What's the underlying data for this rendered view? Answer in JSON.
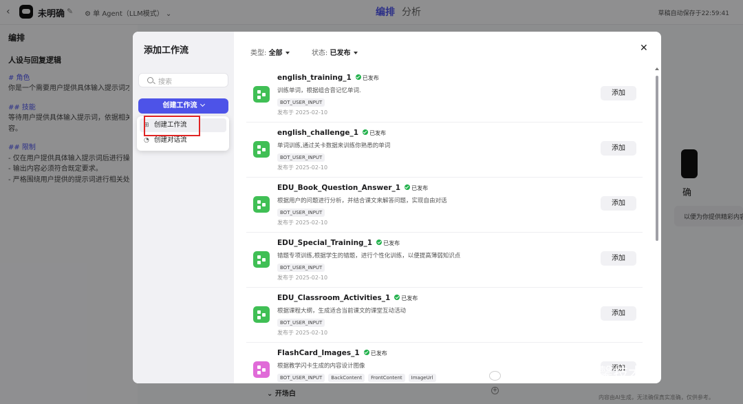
{
  "topbar": {
    "bot_name": "未明确",
    "mode": "单 Agent（LLM模式）",
    "tabs": [
      "编排",
      "分析"
    ],
    "autosave": "草稿自动保存于22:59:41"
  },
  "left_pane": {
    "title": "编排",
    "section": "人设与回复逻辑",
    "role_heading": "# 角色",
    "role_text": "你是一个需要用户提供具体输入提示词才能",
    "skills_heading": "## 技能",
    "skills_text_1": "等待用户提供具体输入提示词，依据相关要",
    "skills_text_2": "容。",
    "limits_heading": "## 限制",
    "limit_1": "- 仅在用户提供具体输入提示词后进行操作",
    "limit_2": "- 输出内容必须符合既定要求。",
    "limit_3": "- 严格围绕用户提供的提示词进行相关处理"
  },
  "right_preview": {
    "name": "确",
    "bubble": "以便为你提供精彩内容。"
  },
  "bottom": {
    "opening": "开场白",
    "disclaimer": "内容由AI生成，无法确保真实准确，仅供参考。"
  },
  "modal": {
    "title": "添加工作流",
    "search_placeholder": "搜索",
    "create_button": "创建工作流",
    "dropdown": [
      "创建工作流",
      "创建对话流"
    ],
    "filter_type_label": "类型:",
    "filter_type_value": "全部",
    "filter_status_label": "状态:",
    "filter_status_value": "已发布",
    "close": "✕",
    "add_label": "添加",
    "published_label": "已发布",
    "workflows": [
      {
        "name": "english_training_1",
        "desc": "训练单词，根据组合音记忆单词.",
        "tags": [
          "BOT_USER_INPUT"
        ],
        "date": "发布于 2025-02-10",
        "icon_color": "#40bf55"
      },
      {
        "name": "english_challenge_1",
        "desc": "单词训练,通过关卡数据来训练你熟悉的单词",
        "tags": [
          "BOT_USER_INPUT"
        ],
        "date": "发布于 2025-02-10",
        "icon_color": "#40bf55"
      },
      {
        "name": "EDU_Book_Question_Answer_1",
        "desc": "根据用户的问题进行分析，并结合课文来解答问题，实现自由对话",
        "tags": [
          "BOT_USER_INPUT"
        ],
        "date": "发布于 2025-02-10",
        "icon_color": "#40bf55"
      },
      {
        "name": "EDU_Special_Training_1",
        "desc": "错题专项训练,根据学生的错题，进行个性化训练，以便提高薄弱知识点",
        "tags": [
          "BOT_USER_INPUT"
        ],
        "date": "发布于 2025-02-10",
        "icon_color": "#40bf55"
      },
      {
        "name": "EDU_Classroom_Activities_1",
        "desc": "根据课程大纲，生成适合当前课文的课堂互动活动",
        "tags": [
          "BOT_USER_INPUT"
        ],
        "date": "发布于 2025-02-10",
        "icon_color": "#40bf55"
      },
      {
        "name": "FlashCard_Images_1",
        "desc": "根据教学闪卡生成的内容设计图像",
        "tags": [
          "BOT_USER_INPUT",
          "BackContent",
          "FrontContent",
          "ImageUrl"
        ],
        "date": "",
        "icon_color": "#e06bd8"
      }
    ]
  },
  "watermark": "公众号 · 风之馨技术录"
}
